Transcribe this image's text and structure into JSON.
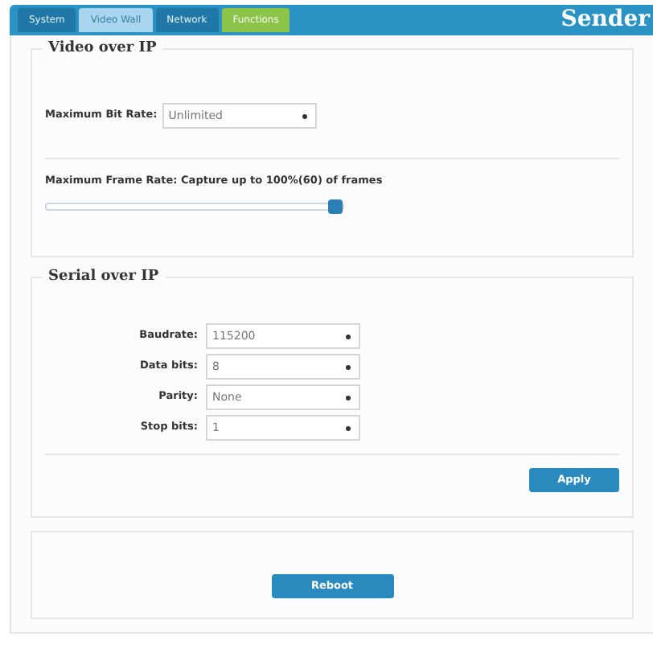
{
  "tabs": [
    {
      "label": "System",
      "selected": false,
      "kind": "normal"
    },
    {
      "label": "Video Wall",
      "selected": true,
      "kind": "normal"
    },
    {
      "label": "Network",
      "selected": false,
      "kind": "normal"
    },
    {
      "label": "Functions",
      "selected": false,
      "kind": "accent"
    }
  ],
  "brand": "Sender",
  "video": {
    "legend": "Video over IP",
    "bit_rate": {
      "label": "Maximum Bit Rate:",
      "value": "Unlimited"
    },
    "frame_rate": {
      "label": "Maximum Frame Rate: Capture up to 100%(60) of frames",
      "level": 1
    }
  },
  "serial": {
    "legend": "Serial over IP",
    "fields": [
      {
        "label": "Baudrate:",
        "value": "115200"
      },
      {
        "label": "Data bits:",
        "value": "8"
      },
      {
        "label": "Parity:",
        "value": "None"
      },
      {
        "label": "Stop bits:",
        "value": "1"
      }
    ],
    "apply": "Apply"
  },
  "reboot": "Reboot"
}
